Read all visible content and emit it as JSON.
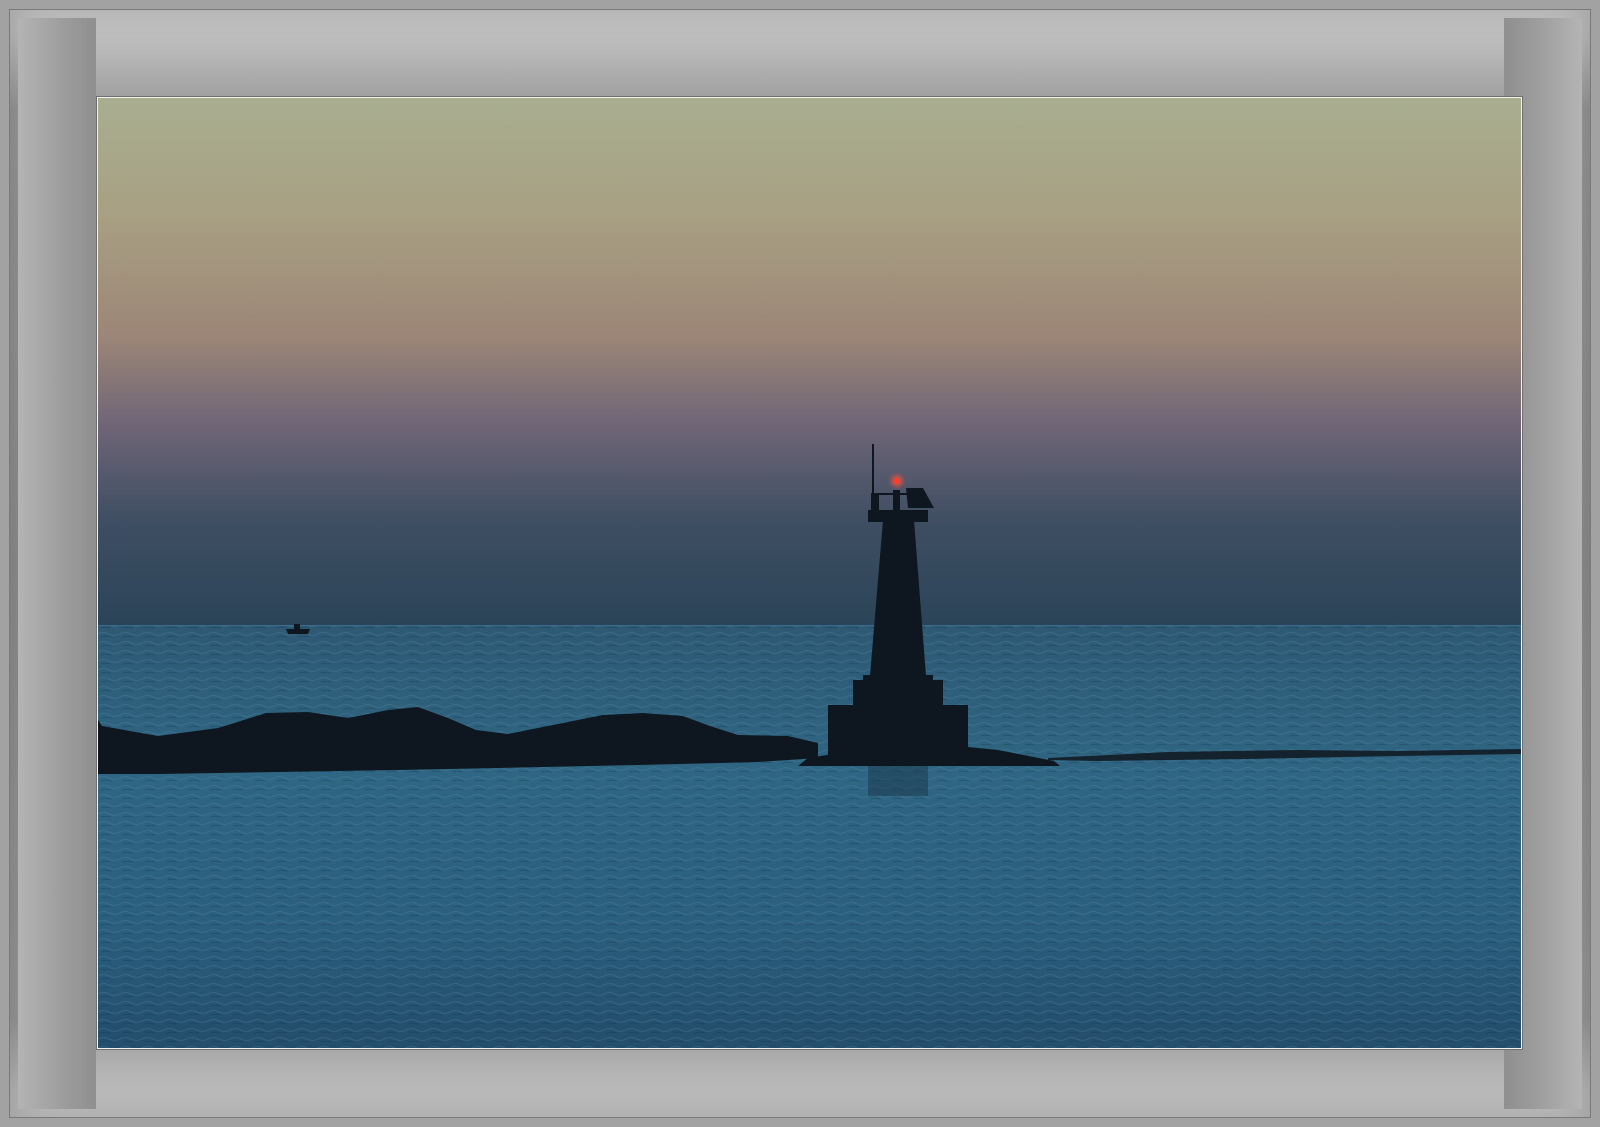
{
  "frame": {
    "outer_color": "#a2a2a2",
    "mat_color": "#909090",
    "photo_border_color": "#f2f2f2"
  },
  "scene": {
    "sky_colors": [
      "#a9ae90",
      "#a8a083",
      "#9c8677",
      "#6f6577",
      "#3f4e62",
      "#2b4458"
    ],
    "sea_colors": [
      "#2e5974",
      "#2f6683",
      "#2b5f7e",
      "#234d6b"
    ],
    "silhouette_color": "#0e1720",
    "beacon_color": "#ff3b2a"
  }
}
